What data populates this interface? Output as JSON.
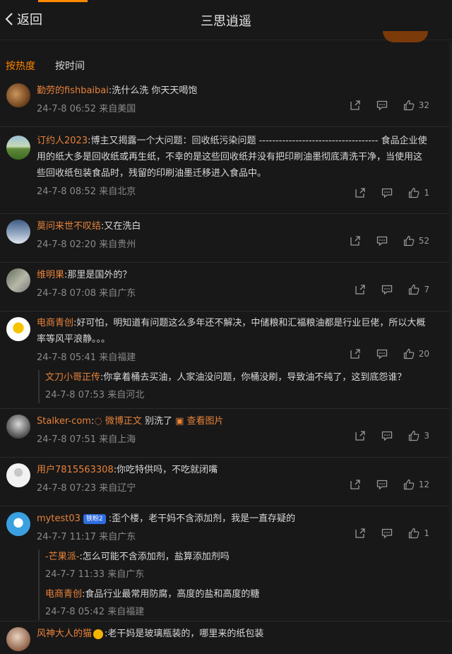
{
  "header": {
    "back_label": "返回",
    "title": "三思逍遥"
  },
  "sort": {
    "hot": "按热度",
    "time": "按时间"
  },
  "colors": {
    "accent": "#ff8200",
    "username": "#e8823a",
    "bg": "#181818"
  },
  "comments": [
    {
      "user": "勤劳的fishbaibai",
      "text": ":洗什么洗 你天天喝饱",
      "meta": "24-7-8 06:52 来自美国",
      "likes": "32"
    },
    {
      "user": "订约人2023",
      "text": ":博主又揭露一个大问题：回收纸污染问题 ------------------------------------ 食品企业使用的纸大多是回收纸或再生纸，不幸的是这些回收纸并没有把印刷油墨彻底清洗干净，当使用这些回收纸包装食品时，残留的印刷油墨迁移进入食品中。",
      "meta": "24-7-8 08:52 来自北京",
      "likes": "1"
    },
    {
      "user": "莫问来世不叹结",
      "text": ":又在洗白",
      "meta": "24-7-8 02:20 来自贵州",
      "likes": "52"
    },
    {
      "user": "维明果",
      "text": ":那里是国外的？",
      "meta": "24-7-8 07:08 来自广东",
      "likes": "7"
    },
    {
      "user": "电商青创",
      "text": ":好可怕，明知道有问题这么多年还不解决，中储粮和汇福粮油都是行业巨佬，所以大概率等风平浪静。。。",
      "meta": "24-7-8 05:41 来自福建",
      "likes": "20",
      "reply": {
        "user": "文刀小哥正传",
        "text": ":你拿着桶去买油，人家油没问题，你桶没刷，导致油不纯了，这到底怨谁？",
        "meta": "24-7-8 07:53 来自河北"
      }
    },
    {
      "user": "Stalker-com",
      "text": ":",
      "link1": "微博正文",
      "mid": " 别洗了 ",
      "link2": "查看图片",
      "meta": "24-7-8 07:51 来自上海",
      "likes": "3"
    },
    {
      "user": "用户7815563308",
      "text": ":你吃特供吗，不吃就闭嘴",
      "meta": "24-7-8 07:23 来自辽宁",
      "likes": "12"
    },
    {
      "user": "mytest03",
      "badge": "铁粉2",
      "text": ":歪个楼，老干妈不含添加剂，我是一直存疑的",
      "meta": "24-7-7 11:17 来自广东",
      "likes": "1",
      "replies": [
        {
          "user": "-芒果派-",
          "text": ":怎么可能不含添加剂，盐算添加剂吗",
          "meta": "24-7-7 11:33 来自广东"
        },
        {
          "user": "电商青创",
          "text": ":食品行业最常用防腐，高度的盐和高度的糖",
          "meta": "24-7-8 05:42 来自福建"
        }
      ]
    },
    {
      "user": "风神大人的猫",
      "text": ":老干妈是玻璃瓶装的，哪里来的纸包装"
    }
  ]
}
